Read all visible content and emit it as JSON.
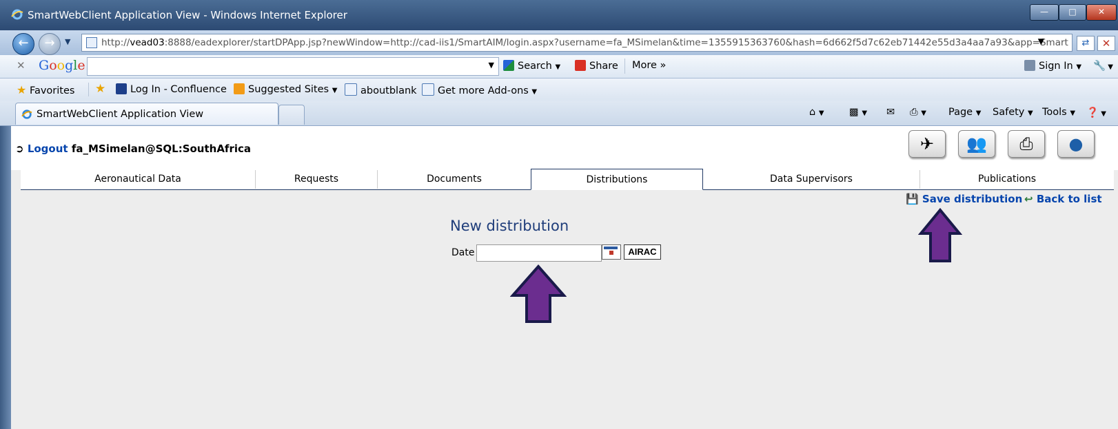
{
  "window": {
    "title": "SmartWebClient Application View - Windows Internet Explorer"
  },
  "address": {
    "url_prefix": "http://",
    "url_host": "vead03",
    "url_rest": ":8888/eadexplorer/startDPApp.jsp?newWindow=http://cad-iis1/SmartAIM/login.aspx?username=fa_MSimelan&time=1355915363760&hash=6d662f5d7c62eb71442e55d3a4aa7a93&app=Smart"
  },
  "google_bar": {
    "logo": "Google",
    "search_label": "Search",
    "share_label": "Share",
    "more_label": "More »",
    "signin_label": "Sign In"
  },
  "favorites_bar": {
    "favorites_label": "Favorites",
    "items": [
      "Log In - Confluence",
      "Suggested Sites",
      "aboutblank",
      "Get more Add-ons"
    ]
  },
  "tab_row": {
    "active_tab": "SmartWebClient Application View",
    "page_label": "Page",
    "safety_label": "Safety",
    "tools_label": "Tools"
  },
  "app": {
    "logout_label": "Logout",
    "user": "fa_MSimelan@SQL:SouthAfrica",
    "tabs": [
      "Aeronautical Data",
      "Requests",
      "Documents",
      "Distributions",
      "Data Supervisors",
      "Publications"
    ],
    "active_tab": "Distributions",
    "save_label": "Save distribution",
    "back_label": "Back to list",
    "form_title": "New distribution",
    "date_label": "Date",
    "date_value": "",
    "airac_label": "AIRAC"
  },
  "colors": {
    "accent_arrow": "#6b2d8f",
    "arrow_outline": "#1a1a4a",
    "link": "#0645ad"
  }
}
